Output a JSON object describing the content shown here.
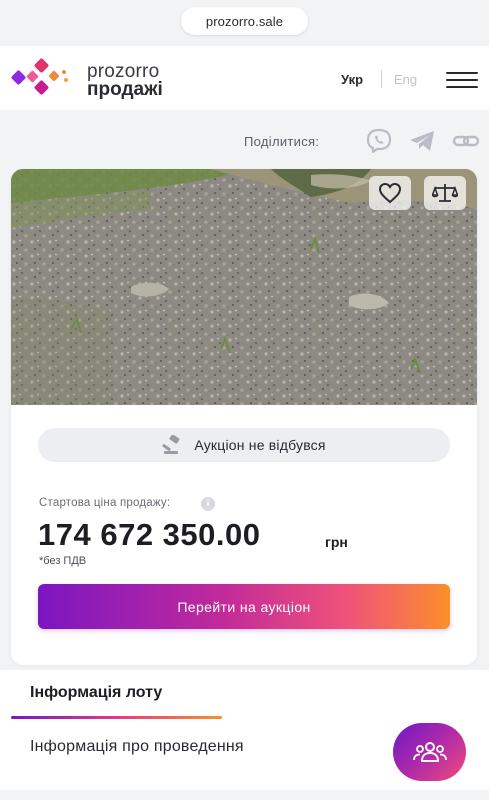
{
  "browser": {
    "url": "prozorro.sale"
  },
  "header": {
    "brand_top": "prozorro",
    "brand_bottom": "продажі",
    "lang_ukr": "Укр",
    "lang_eng": "Eng",
    "menu_icon": "hamburger-menu-icon"
  },
  "share": {
    "label": "Поділитися:",
    "icons": [
      "viber-icon",
      "telegram-icon",
      "link-icon"
    ]
  },
  "lot": {
    "status": "Аукціон не відбувся",
    "status_icon": "gavel-icon",
    "price_label": "Стартова ціна продажу:",
    "info_icon": "i",
    "price": "174 672 350.00",
    "currency": "грн",
    "vat_note": "*без ПДВ",
    "cta_label": "Перейти на аукціон",
    "favorite_icon": "heart-icon",
    "compare_icon": "scales-icon"
  },
  "tabs": {
    "lot_info": "Інформація лоту",
    "conduct_info": "Інформація про проведення"
  },
  "fab": {
    "icon": "people-group-icon"
  },
  "colors": {
    "accent_purple": "#7b16c2",
    "accent_orange": "#fb8f2a",
    "logo_pink": "#e0336f",
    "logo_purple": "#8a2be2"
  }
}
